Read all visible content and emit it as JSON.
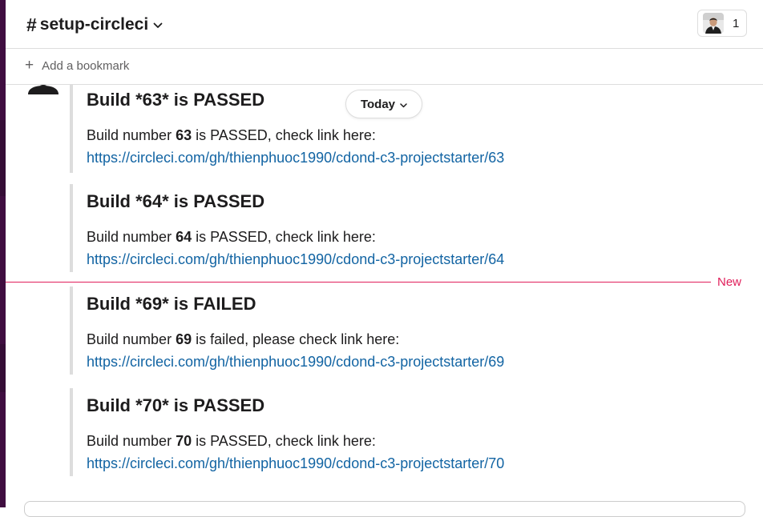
{
  "channel": {
    "hash": "#",
    "name": "setup-circleci",
    "member_count": "1"
  },
  "bookmarks": {
    "add_label": "Add a bookmark"
  },
  "date_pill": {
    "label": "Today"
  },
  "new_divider": {
    "label": "New"
  },
  "messages": [
    {
      "title": "Build *63* is PASSED",
      "text_prefix": "Build number ",
      "number": "63",
      "text_suffix": " is PASSED, check link here:",
      "link": "https://circleci.com/gh/thienphuoc1990/cdond-c3-projectstarter/63"
    },
    {
      "title": "Build *64* is PASSED",
      "text_prefix": "Build number ",
      "number": "64",
      "text_suffix": " is PASSED, check link here:",
      "link": "https://circleci.com/gh/thienphuoc1990/cdond-c3-projectstarter/64"
    },
    {
      "title": "Build *69* is FAILED",
      "text_prefix": "Build number ",
      "number": "69",
      "text_suffix": " is failed, please check link here:",
      "link": "https://circleci.com/gh/thienphuoc1990/cdond-c3-projectstarter/69"
    },
    {
      "title": "Build *70* is PASSED",
      "text_prefix": "Build number ",
      "number": "70",
      "text_suffix": " is PASSED, check link here:",
      "link": "https://circleci.com/gh/thienphuoc1990/cdond-c3-projectstarter/70"
    }
  ],
  "colors": {
    "sidebar": "#3f0e40",
    "link": "#1264a3",
    "new_divider": "#e01e5a",
    "attachment_bar": "#dddddd"
  },
  "icons": {
    "channel_chevron": "chevron-down-icon",
    "bookmark_add": "plus-icon",
    "member_avatar": "user-avatar-icon",
    "sender_avatar": "default-user-avatar-icon"
  }
}
